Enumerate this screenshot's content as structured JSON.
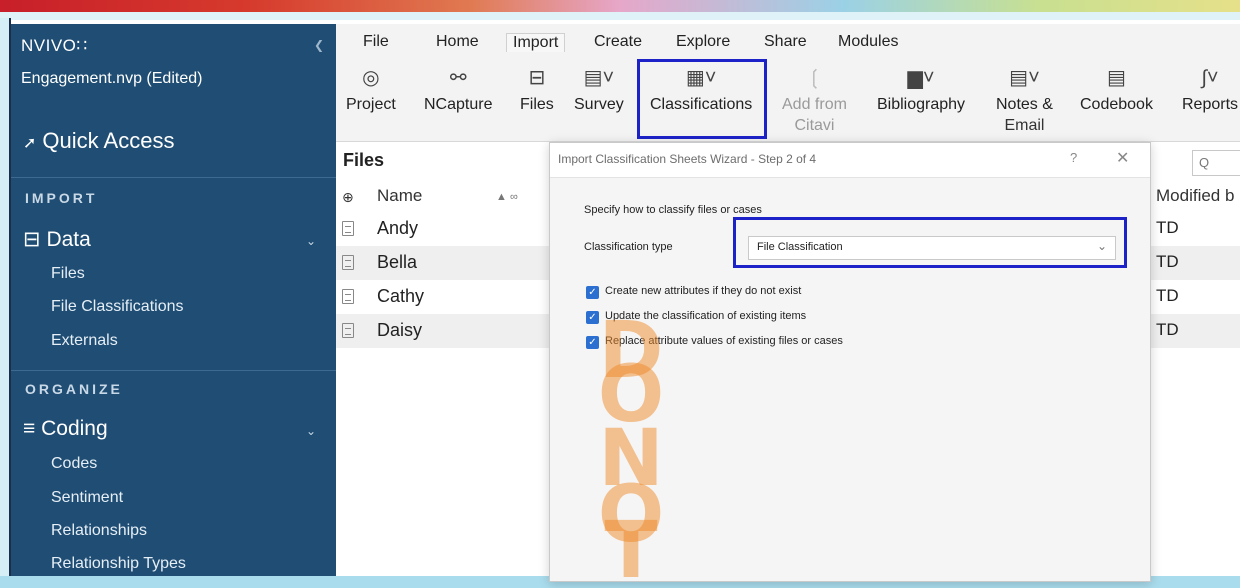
{
  "sidebar": {
    "brand": "NVIVO∷",
    "project": "Engagement.nvp (Edited)",
    "quick_access": "Quick Access",
    "sections": {
      "import": "IMPORT",
      "organize": "ORGANIZE"
    },
    "data_group": "Data",
    "data_items": [
      "Files",
      "File Classifications",
      "Externals"
    ],
    "coding_group": "Coding",
    "coding_items": [
      "Codes",
      "Sentiment",
      "Relationships",
      "Relationship Types"
    ]
  },
  "ribbon": {
    "tabs": [
      "File",
      "Home",
      "Import",
      "Create",
      "Explore",
      "Share",
      "Modules"
    ],
    "active_tab": "Import",
    "buttons": {
      "project": "Project",
      "ncapture": "NCapture",
      "files": "Files",
      "survey": "Survey",
      "classifications": "Classifications",
      "add_from": "Add from",
      "citavi": "Citavi",
      "bibliography": "Bibliography",
      "notes": "Notes &",
      "email": "Email",
      "codebook": "Codebook",
      "reports": "Reports"
    }
  },
  "files_panel": {
    "title": "Files",
    "search_placeholder": "Q",
    "col_name": "Name",
    "col_modified_by": "Modified b",
    "rows": [
      {
        "name": "Andy",
        "modified_by": "TD"
      },
      {
        "name": "Bella",
        "modified_by": "TD"
      },
      {
        "name": "Cathy",
        "modified_by": "TD"
      },
      {
        "name": "Daisy",
        "modified_by": "TD"
      }
    ]
  },
  "dialog": {
    "title": "Import Classification Sheets Wizard - Step 2 of 4",
    "help": "?",
    "close": "✕",
    "instruction": "Specify how to classify files or cases",
    "classification_type_label": "Classification type",
    "classification_type_value": "File Classification",
    "options": [
      {
        "label": "Create new attributes if they do not exist",
        "checked": true
      },
      {
        "label": "Update the classification of existing items",
        "checked": true
      },
      {
        "label": "Replace attribute values of existing files or cases",
        "checked": true
      }
    ]
  },
  "watermark": [
    "D",
    "O",
    "N",
    "O",
    "T"
  ],
  "colors": {
    "sidebar": "#1f4d73",
    "highlight_box": "#1d22c8",
    "checkbox": "#2b6fd1",
    "watermark": "#f08a2a"
  }
}
